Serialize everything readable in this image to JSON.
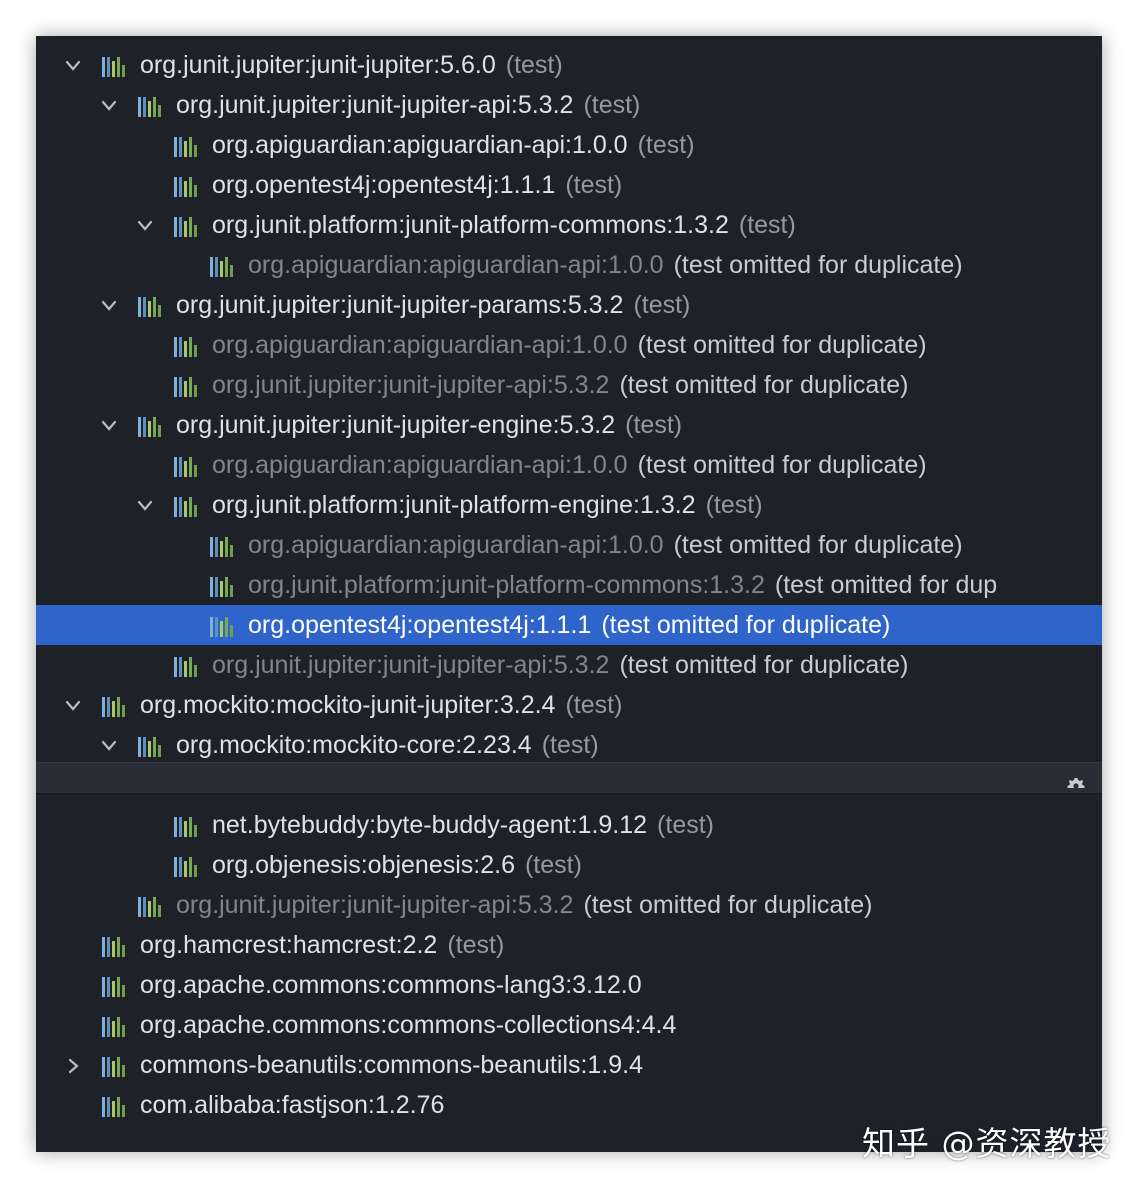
{
  "colors": {
    "panel_bg": "#1f2129",
    "selection": "#2f65ca",
    "text": "#dfe1e5",
    "muted_text": "#80858f",
    "scope_text": "#9599a0"
  },
  "rows": [
    {
      "indent": 0,
      "chevron": "down",
      "name": "org.junit.jupiter:junit-jupiter:5.6.0",
      "scope": "(test)",
      "muted": false
    },
    {
      "indent": 1,
      "chevron": "down",
      "name": "org.junit.jupiter:junit-jupiter-api:5.3.2",
      "scope": "(test)",
      "muted": false
    },
    {
      "indent": 2,
      "chevron": "none",
      "name": "org.apiguardian:apiguardian-api:1.0.0",
      "scope": "(test)",
      "muted": false
    },
    {
      "indent": 2,
      "chevron": "none",
      "name": "org.opentest4j:opentest4j:1.1.1",
      "scope": "(test)",
      "muted": false
    },
    {
      "indent": 2,
      "chevron": "down",
      "name": "org.junit.platform:junit-platform-commons:1.3.2",
      "scope": "(test)",
      "muted": false
    },
    {
      "indent": 3,
      "chevron": "none",
      "name": "org.apiguardian:apiguardian-api:1.0.0",
      "scope": "(test omitted for duplicate)",
      "muted": true
    },
    {
      "indent": 1,
      "chevron": "down",
      "name": "org.junit.jupiter:junit-jupiter-params:5.3.2",
      "scope": "(test)",
      "muted": false
    },
    {
      "indent": 2,
      "chevron": "none",
      "name": "org.apiguardian:apiguardian-api:1.0.0",
      "scope": "(test omitted for duplicate)",
      "muted": true
    },
    {
      "indent": 2,
      "chevron": "none",
      "name": "org.junit.jupiter:junit-jupiter-api:5.3.2",
      "scope": "(test omitted for duplicate)",
      "muted": true
    },
    {
      "indent": 1,
      "chevron": "down",
      "name": "org.junit.jupiter:junit-jupiter-engine:5.3.2",
      "scope": "(test)",
      "muted": false
    },
    {
      "indent": 2,
      "chevron": "none",
      "name": "org.apiguardian:apiguardian-api:1.0.0",
      "scope": "(test omitted for duplicate)",
      "muted": true
    },
    {
      "indent": 2,
      "chevron": "down",
      "name": "org.junit.platform:junit-platform-engine:1.3.2",
      "scope": "(test)",
      "muted": false
    },
    {
      "indent": 3,
      "chevron": "none",
      "name": "org.apiguardian:apiguardian-api:1.0.0",
      "scope": "(test omitted for duplicate)",
      "muted": true
    },
    {
      "indent": 3,
      "chevron": "none",
      "name": "org.junit.platform:junit-platform-commons:1.3.2",
      "scope": "(test omitted for dup",
      "muted": true
    },
    {
      "indent": 3,
      "chevron": "none",
      "name": "org.opentest4j:opentest4j:1.1.1",
      "scope": "(test omitted for duplicate)",
      "muted": true,
      "selected": true
    },
    {
      "indent": 2,
      "chevron": "none",
      "name": "org.junit.jupiter:junit-jupiter-api:5.3.2",
      "scope": "(test omitted for duplicate)",
      "muted": true
    },
    {
      "indent": 0,
      "chevron": "down",
      "name": "org.mockito:mockito-junit-jupiter:3.2.4",
      "scope": "(test)",
      "muted": false
    },
    {
      "indent": 1,
      "chevron": "down",
      "name": "org.mockito:mockito-core:2.23.4",
      "scope": "(test)",
      "muted": false
    },
    {
      "indent": 2,
      "chevron": "none",
      "name": "",
      "scope": "",
      "muted": false,
      "hidden": true
    },
    {
      "indent": 2,
      "chevron": "none",
      "name": "net.bytebuddy:byte-buddy-agent:1.9.12",
      "scope": "(test)",
      "muted": false
    },
    {
      "indent": 2,
      "chevron": "none",
      "name": "org.objenesis:objenesis:2.6",
      "scope": "(test)",
      "muted": false
    },
    {
      "indent": 1,
      "chevron": "none",
      "name": "org.junit.jupiter:junit-jupiter-api:5.3.2",
      "scope": "(test omitted for duplicate)",
      "muted": true
    },
    {
      "indent": 0,
      "chevron": "none",
      "name": "org.hamcrest:hamcrest:2.2",
      "scope": "(test)",
      "muted": false
    },
    {
      "indent": 0,
      "chevron": "none",
      "name": "org.apache.commons:commons-lang3:3.12.0",
      "scope": "",
      "muted": false
    },
    {
      "indent": 0,
      "chevron": "none",
      "name": "org.apache.commons:commons-collections4:4.4",
      "scope": "",
      "muted": false
    },
    {
      "indent": 0,
      "chevron": "right",
      "name": "commons-beanutils:commons-beanutils:1.9.4",
      "scope": "",
      "muted": false
    },
    {
      "indent": 0,
      "chevron": "none",
      "name": "com.alibaba:fastjson:1.2.76",
      "scope": "",
      "muted": false
    }
  ],
  "toolbar": {
    "gear_icon": "gear-icon"
  },
  "watermark": "知乎 @资深教授"
}
